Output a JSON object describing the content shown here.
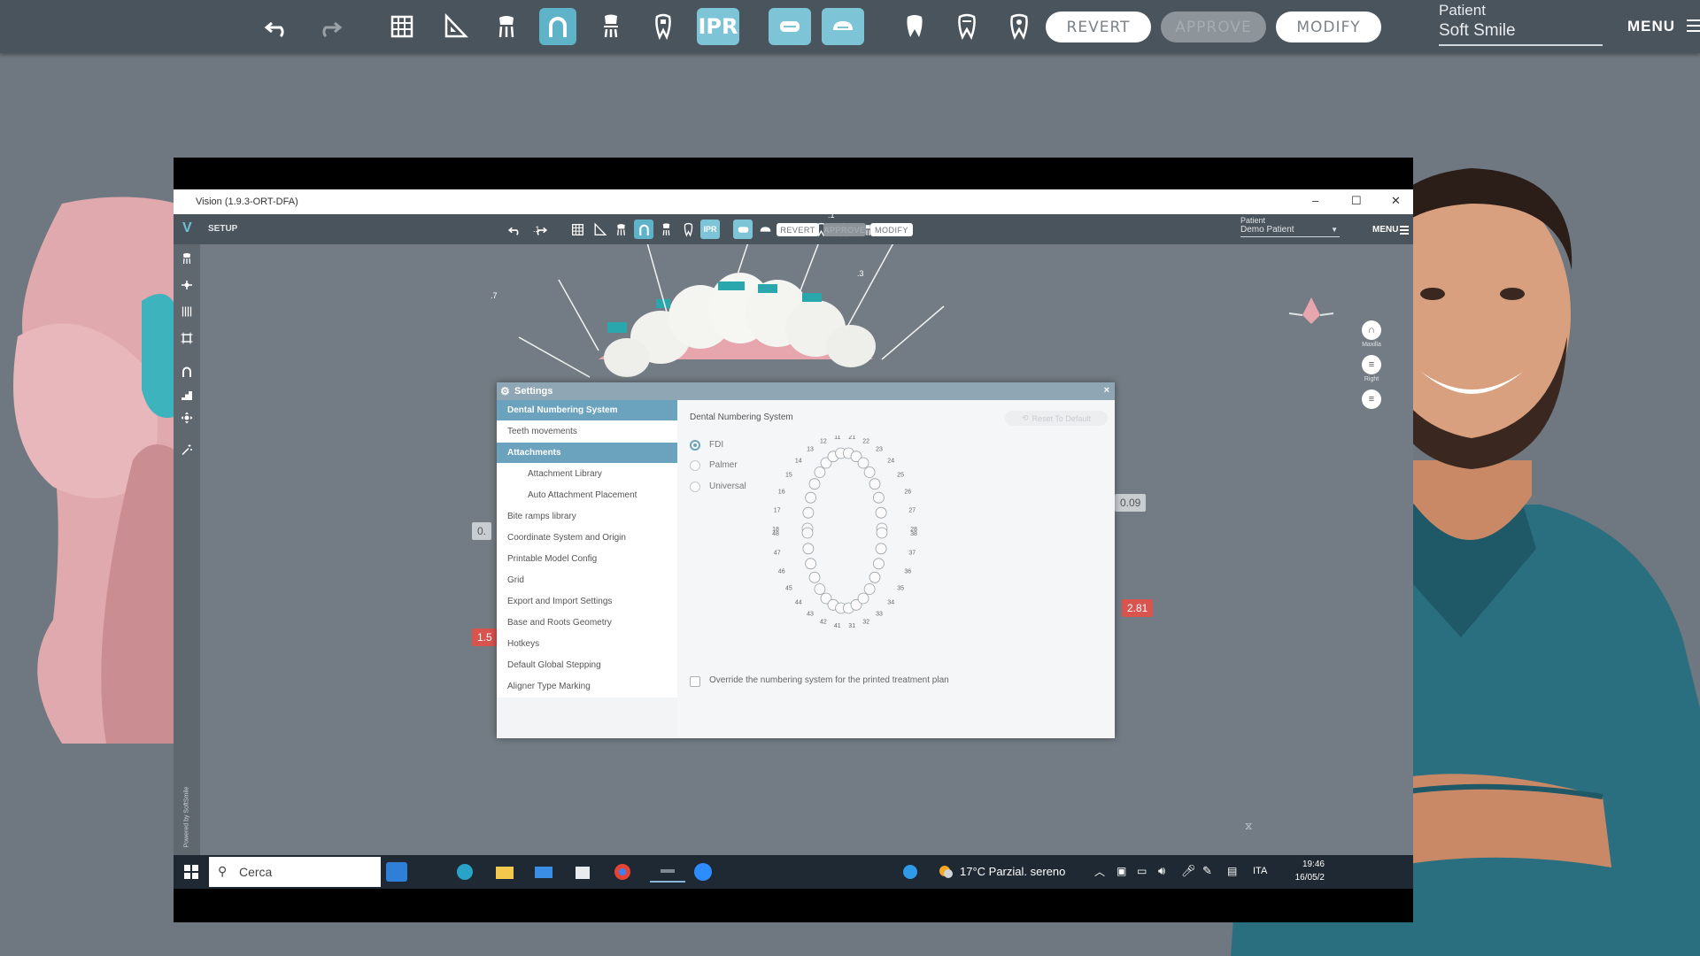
{
  "outer_toolbar": {
    "ipr_label": "IPR",
    "revert_label": "REVERT",
    "approve_label": "APPROVE",
    "modify_label": "MODIFY",
    "patient_label": "Patient",
    "patient_name": "Soft Smile",
    "menu_label": "MENU"
  },
  "window": {
    "title": "Vision (1.9.3-ORT-DFA)",
    "minimize": "–",
    "maximize": "☐",
    "close": "✕",
    "logo": "V",
    "mode_label": "SETUP",
    "ipr_label": "IPR",
    "revert_label": "REVERT",
    "approve_label": "APPROVE",
    "modify_label": "MODIFY",
    "patient_label": "Patient",
    "patient_name": "Demo Patient",
    "menu_label": "MENU",
    "scene_labels": {
      "label_a": "0.09",
      "label_b": "2.81",
      "label_c": "0.",
      "label_d": "1.5",
      "marker_1": ".1",
      "marker_2": ".1",
      "marker_3": ".3",
      "marker_4": ".7"
    },
    "right_tools": [
      {
        "icon": "arch-icon",
        "label": "Maxilla"
      },
      {
        "icon": "right-view-icon",
        "label": "Right"
      }
    ],
    "brand_vertical": "Powered by SoftSmile"
  },
  "settings": {
    "title": "Settings",
    "close": "×",
    "sidebar": [
      {
        "label": "Dental Numbering System",
        "selected": true,
        "sub": false
      },
      {
        "label": "Teeth movements",
        "selected": false,
        "sub": false
      },
      {
        "label": "Attachments",
        "selected": true,
        "sub": false
      },
      {
        "label": "Attachment Library",
        "selected": false,
        "sub": true
      },
      {
        "label": "Auto Attachment Placement",
        "selected": false,
        "sub": true
      },
      {
        "label": "Bite ramps library",
        "selected": false,
        "sub": false
      },
      {
        "label": "Coordinate System and Origin",
        "selected": false,
        "sub": false
      },
      {
        "label": "Printable Model Config",
        "selected": false,
        "sub": false
      },
      {
        "label": "Grid",
        "selected": false,
        "sub": false
      },
      {
        "label": "Export and Import Settings",
        "selected": false,
        "sub": false
      },
      {
        "label": "Base and Roots Geometry",
        "selected": false,
        "sub": false
      },
      {
        "label": "Hotkeys",
        "selected": false,
        "sub": false
      },
      {
        "label": "Default Global Stepping",
        "selected": false,
        "sub": false
      },
      {
        "label": "Aligner Type Marking",
        "selected": false,
        "sub": false
      }
    ],
    "section_title": "Dental Numbering System",
    "reset_label": "Reset To Default",
    "options": [
      {
        "label": "FDI",
        "checked": true
      },
      {
        "label": "Palmer",
        "checked": false
      },
      {
        "label": "Universal",
        "checked": false
      }
    ],
    "upper_numbers": [
      "18",
      "17",
      "16",
      "15",
      "14",
      "13",
      "12",
      "11",
      "21",
      "22",
      "23",
      "24",
      "25",
      "26",
      "27",
      "28"
    ],
    "lower_numbers": [
      "48",
      "47",
      "46",
      "45",
      "44",
      "43",
      "42",
      "41",
      "31",
      "32",
      "33",
      "34",
      "35",
      "36",
      "37",
      "38"
    ],
    "override_label": "Override the numbering system for the printed treatment plan",
    "override_checked": false
  },
  "taskbar": {
    "search_label": "Cerca",
    "weather": "17°C  Parzial. sereno",
    "language": "ITA",
    "time": "19:46",
    "date": "16/05/2"
  }
}
